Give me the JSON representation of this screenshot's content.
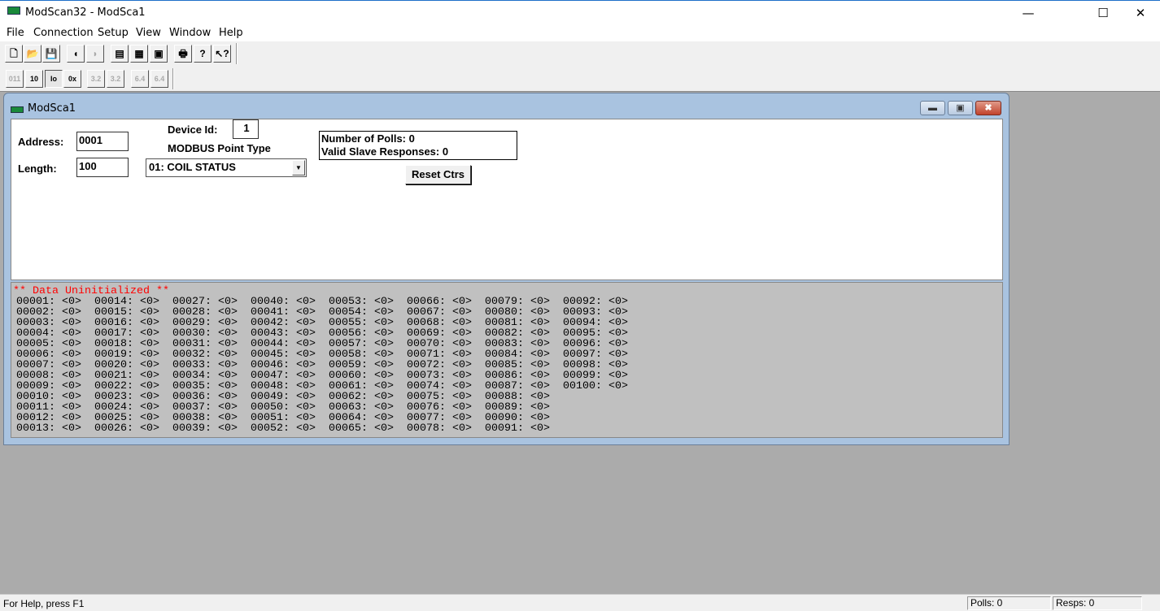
{
  "app": {
    "title": "ModScan32 - ModSca1",
    "minimize": "—",
    "maximize": "☐",
    "close": "✕"
  },
  "menu": [
    "File",
    "Connection",
    "Setup",
    "View",
    "Window",
    "Help"
  ],
  "toolbar1": [
    {
      "icon": "new-file-icon",
      "glyph": "🗋"
    },
    {
      "icon": "open-folder-icon",
      "glyph": "📂"
    },
    {
      "icon": "save-icon",
      "glyph": "💾"
    },
    {
      "icon": "connect-icon",
      "glyph": "◖"
    },
    {
      "icon": "disconnect-icon",
      "glyph": "◗",
      "disabled": true
    },
    {
      "icon": "tile-windows-icon",
      "glyph": "▤"
    },
    {
      "icon": "display-options-icon",
      "glyph": "▦"
    },
    {
      "icon": "show-traffic-icon",
      "glyph": "▣"
    },
    {
      "icon": "print-icon",
      "glyph": "🖶"
    },
    {
      "icon": "help-icon",
      "glyph": "?"
    },
    {
      "icon": "context-help-icon",
      "glyph": "↖?"
    }
  ],
  "toolbar2": [
    {
      "icon": "binary-format-icon",
      "glyph": "011",
      "disabled": true
    },
    {
      "icon": "decimal-format-icon",
      "glyph": "10"
    },
    {
      "icon": "integer-format-icon",
      "glyph": "Io",
      "pressed": true
    },
    {
      "icon": "hex-format-icon",
      "glyph": "0x"
    },
    {
      "icon": "float-format-icon",
      "glyph": "3.2",
      "disabled": true
    },
    {
      "icon": "float-swapped-format-icon",
      "glyph": "3.2",
      "disabled": true
    },
    {
      "icon": "double-format-icon",
      "glyph": "6.4",
      "disabled": true
    },
    {
      "icon": "double-swapped-format-icon",
      "glyph": "6.4",
      "disabled": true
    }
  ],
  "child": {
    "title": "ModSca1",
    "minimize": "▬",
    "maximize": "▣",
    "close": "✖"
  },
  "form": {
    "address_label": "Address:",
    "address": "0001",
    "length_label": "Length:",
    "length": "100",
    "device_id_label": "Device Id:",
    "device_id": "1",
    "point_type_label": "MODBUS Point Type",
    "point_type": "01: COIL STATUS",
    "polls": "Number of Polls: 0",
    "responses": "Valid Slave Responses: 0",
    "reset": "Reset Ctrs"
  },
  "data": {
    "status": "** Data Uninitialized **",
    "value": "<0>",
    "count": 100,
    "first_address": 1
  },
  "statusbar": {
    "help": "For Help, press F1",
    "polls": "Polls: 0",
    "resps": "Resps: 0"
  }
}
